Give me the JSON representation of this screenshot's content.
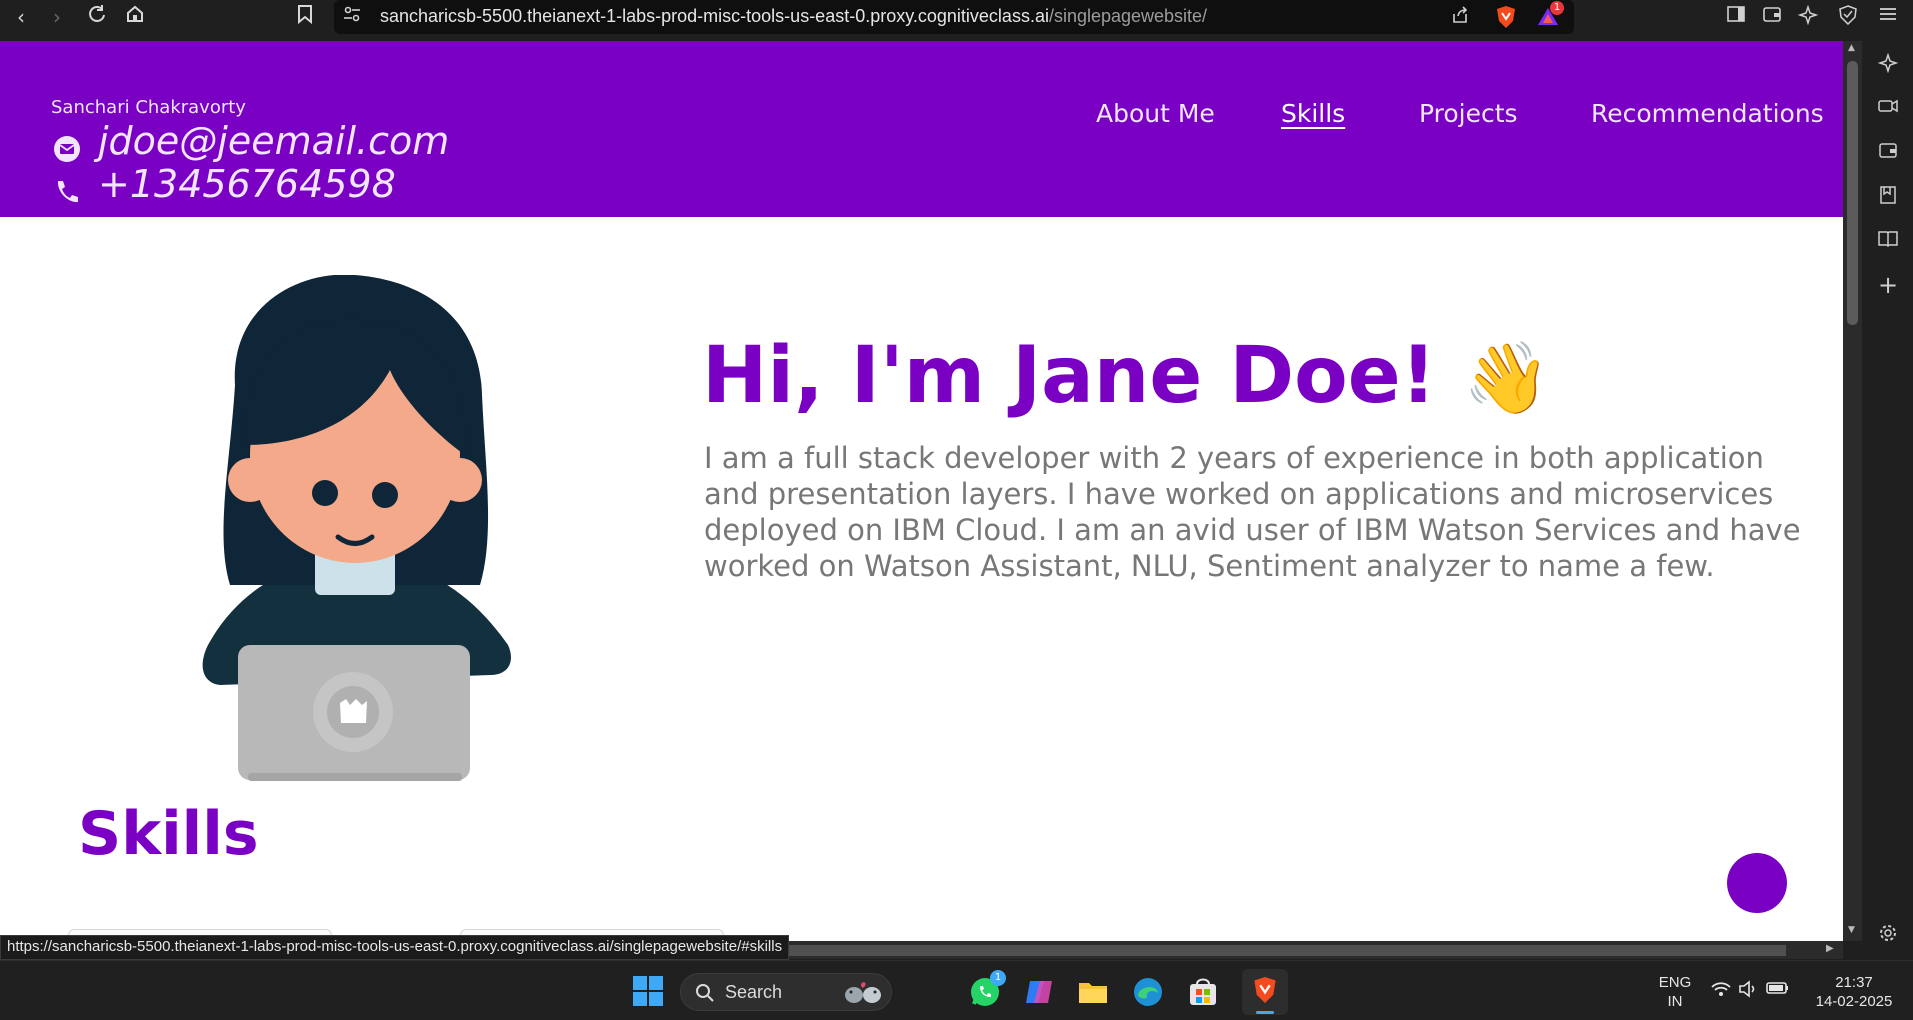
{
  "browser": {
    "url_main": "sancharicsb-5500.theianext-1-labs-prod-misc-tools-us-east-0.proxy.cognitiveclass.ai",
    "url_path": "/singlepagewebsite/",
    "notification_count": "1"
  },
  "site": {
    "owner_name": "Sanchari Chakravorty",
    "email": "jdoe@jeemail.com",
    "phone": "+13456764598",
    "nav": [
      {
        "label": "About Me"
      },
      {
        "label": "Skills"
      },
      {
        "label": "Projects"
      },
      {
        "label": "Recommendations"
      }
    ],
    "active_nav": "Skills",
    "hero_title": "Hi, I'm Jane Doe!",
    "hero_emoji": "👋",
    "hero_description": "I am a full stack developer with 2 years of experience in both application and presentation layers. I have worked on applications and microservices deployed on IBM Cloud. I am an avid user of IBM Watson Services and have worked on Watson Assistant, NLU, Sentiment analyzer to name a few.",
    "skills_heading": "Skills"
  },
  "status_bar": {
    "link_preview": "https://sancharicsb-5500.theianext-1-labs-prod-misc-tools-us-east-0.proxy.cognitiveclass.ai/singlepagewebsite/#skills"
  },
  "taskbar": {
    "search_label": "Search",
    "whatsapp_badge": "1",
    "language_line1": "ENG",
    "language_line2": "IN",
    "time": "21:37",
    "date": "14-02-2025"
  },
  "colors": {
    "brand_purple": "#7a00c4",
    "text_grey": "#777777"
  }
}
